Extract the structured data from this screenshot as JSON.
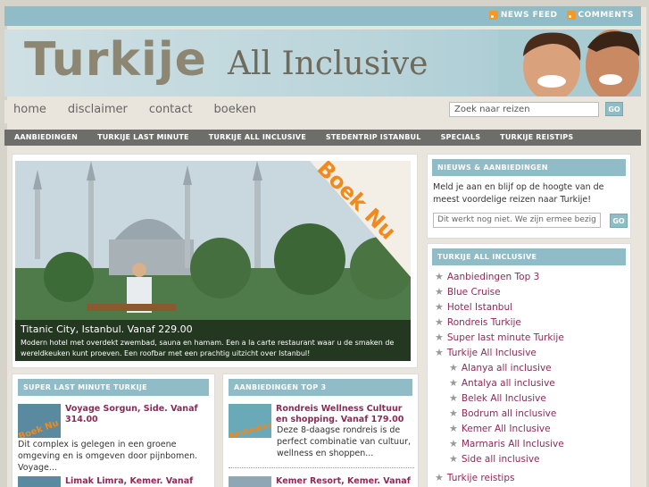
{
  "topbar": {
    "news_feed": "NEWS FEED",
    "comments": "COMMENTS"
  },
  "header": {
    "logo_main": "Turkije",
    "logo_sub": "All Inclusive"
  },
  "nav": {
    "links": [
      "home",
      "disclaimer",
      "contact",
      "boeken"
    ],
    "search_placeholder": "Zoek naar reizen",
    "go": "GO"
  },
  "categories": [
    "AANBIEDINGEN",
    "TURKIJE LAST MINUTE",
    "TURKIJE ALL INCLUSIVE",
    "STEDENTRIP ISTANBUL",
    "SPECIALS",
    "TURKIJE REISTIPS"
  ],
  "featured": {
    "badge": "Boek Nu",
    "title": "Titanic City, Istanbul. Vanaf 229.00",
    "desc": "Modern hotel met overdekt zwembad, sauna en hamam. Een a la carte restaurant waar u de smaken de wereldkeuken kunt proeven. Een roofbar met een prachtig uitzicht over Istanbul!"
  },
  "lastminute": {
    "heading": "SUPER LAST MINUTE TURKIJE",
    "post1_title": "Voyage Sorgun, Side. Vanaf 314.00",
    "post1_text": "Dit complex is gelegen in een groene omgeving en is omgeven door pijnbomen. Voyage...",
    "post2_title": "Limak Limra, Kemer. Vanaf"
  },
  "top3": {
    "heading": "AANBIEDINGEN TOP 3",
    "post1_title": "Rondreis Wellness Cultuur en shopping. Vanaf 179.00",
    "post1_text": "Deze 8-daagse rondreis is de perfect combinatie van cultuur, wellness en shoppen...",
    "post2_title": "Kemer Resort, Kemer. Vanaf"
  },
  "newsletter": {
    "heading": "NIEUWS & AANBIEDINGEN",
    "text": "Meld je aan en blijf op de hoogte van de meest voordelige reizen naar Turkije!",
    "input_value": "Dit werkt nog niet. We zijn ermee bezig",
    "go": "GO"
  },
  "sidebar_list": {
    "heading": "TURKIJE ALL INCLUSIVE",
    "items": [
      "Aanbiedingen Top 3",
      "Blue Cruise",
      "Hotel Istanbul",
      "Rondreis Turkije",
      "Super last minute Turkije",
      "Turkije All Inclusive"
    ],
    "subitems": [
      "Alanya all inclusive",
      "Antalya all inclusive",
      "Belek All Inclusive",
      "Bodrum all inclusive",
      "Kemer All Inclusive",
      "Marmaris All Inclusive",
      "Side all inclusive"
    ],
    "after": "Turkije reistips"
  },
  "colors": {
    "accent": "#8fbcc6",
    "link": "#8c2a57",
    "catbar": "#6d6e6a"
  }
}
